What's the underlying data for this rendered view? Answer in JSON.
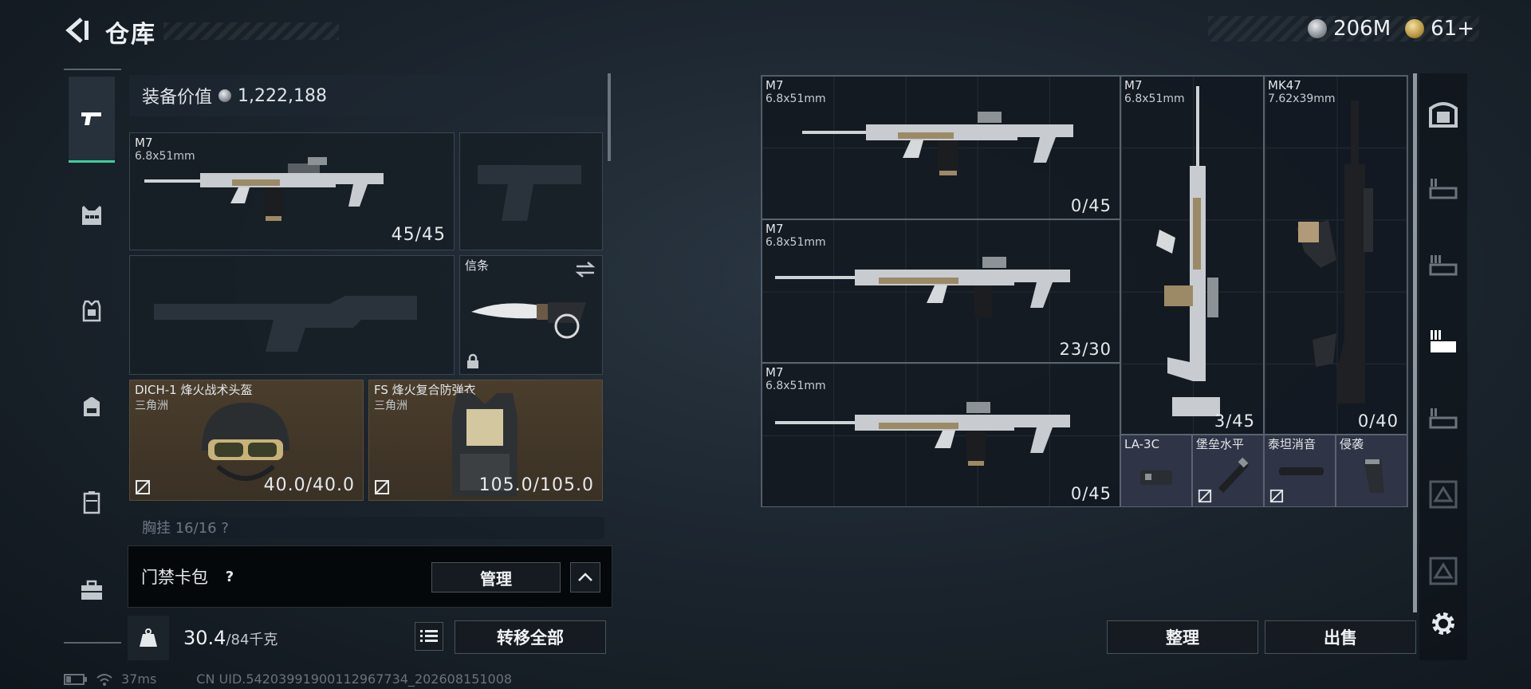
{
  "header": {
    "title": "仓库",
    "currency": [
      {
        "icon": "silver-coin-icon",
        "value": "206M"
      },
      {
        "icon": "gold-coin-icon",
        "value": "61+"
      }
    ]
  },
  "left_nav": [
    {
      "name": "weapons",
      "icon": "pistol-icon",
      "active": true
    },
    {
      "name": "chest-rig",
      "icon": "chest-rig-icon",
      "active": false
    },
    {
      "name": "armor",
      "icon": "armor-icon",
      "active": false
    },
    {
      "name": "backpack",
      "icon": "backpack-icon",
      "active": false
    },
    {
      "name": "container",
      "icon": "container-icon",
      "active": false
    },
    {
      "name": "toolbox",
      "icon": "toolbox-icon",
      "active": false
    }
  ],
  "loadout": {
    "equip_value_label": "装备价值",
    "equip_value": "1,222,188",
    "primary": {
      "name": "M7",
      "caliber": "6.8x51mm",
      "ammo": "45/45"
    },
    "melee": {
      "name": "信条"
    },
    "helmet": {
      "name": "DICH-1 烽火战术头盔",
      "maker": "三角洲",
      "durability": "40.0/40.0"
    },
    "armor": {
      "name": "FS 烽火复合防弹衣",
      "maker": "三角洲",
      "durability": "105.0/105.0"
    },
    "chest_rig_partial": "胸挂 16/16 ?",
    "card_pack_label": "门禁卡包",
    "help_symbol": "?",
    "manage_label": "管理",
    "weight_current": "30.4",
    "weight_max": "/84千克",
    "transfer_all_label": "转移全部"
  },
  "status": {
    "ping": "37ms",
    "uid": "CN UID.54203991900112967734_202608151008"
  },
  "storage": {
    "items": [
      {
        "name": "M7",
        "caliber": "6.8x51mm",
        "ammo": "0/45"
      },
      {
        "name": "M7",
        "caliber": "6.8x51mm",
        "ammo": "23/30"
      },
      {
        "name": "M7",
        "caliber": "6.8x51mm",
        "ammo": "0/45"
      },
      {
        "name": "M7",
        "caliber": "6.8x51mm",
        "ammo": "3/45"
      },
      {
        "name": "MK47",
        "caliber": "7.62x39mm",
        "ammo": "0/40"
      }
    ],
    "attachments": [
      {
        "name": "LA-3C"
      },
      {
        "name": "堡垒水平"
      },
      {
        "name": "泰坦消音"
      },
      {
        "name": "侵袭"
      }
    ],
    "sort_label": "整理",
    "sell_label": "出售"
  },
  "right_nav": [
    {
      "icon": "safe-box-icon"
    },
    {
      "icon": "storage-page-1-icon"
    },
    {
      "icon": "storage-page-2-icon"
    },
    {
      "icon": "storage-page-3-icon"
    },
    {
      "icon": "storage-page-4-icon"
    },
    {
      "icon": "storage-page-5-icon"
    },
    {
      "icon": "storage-page-6-icon"
    }
  ],
  "colors": {
    "accent_green": "#3ccf9c",
    "brown_slot": "#4a3d2c",
    "attachment_slot": "#2f3446"
  }
}
